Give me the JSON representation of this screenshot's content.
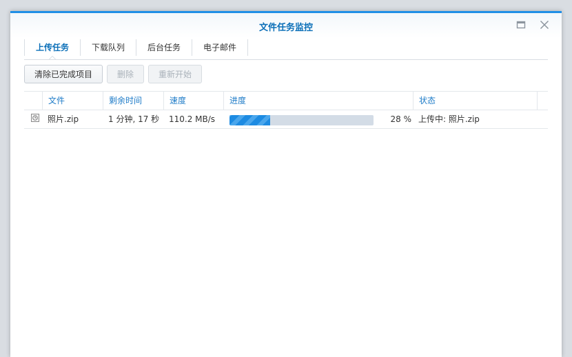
{
  "window": {
    "title": "文件任务监控",
    "accent": "#1f8ee6",
    "maximize_icon": "maximize-icon",
    "close_icon": "close-icon"
  },
  "tabs": [
    {
      "label": "上传任务",
      "active": true
    },
    {
      "label": "下载队列",
      "active": false
    },
    {
      "label": "后台任务",
      "active": false
    },
    {
      "label": "电子邮件",
      "active": false
    }
  ],
  "toolbar": {
    "clear_label": "清除已完成项目",
    "delete_label": "删除",
    "restart_label": "重新开始"
  },
  "table": {
    "columns": [
      "文件",
      "剩余时间",
      "速度",
      "进度",
      "状态"
    ],
    "rows": [
      {
        "icon": "clock-icon",
        "file": "照片.zip",
        "remaining": "1 分钟, 17 秒",
        "speed": "110.2 MB/s",
        "progress": 0.28,
        "progress_text": "28 %",
        "status": "上传中: 照片.zip"
      }
    ]
  }
}
